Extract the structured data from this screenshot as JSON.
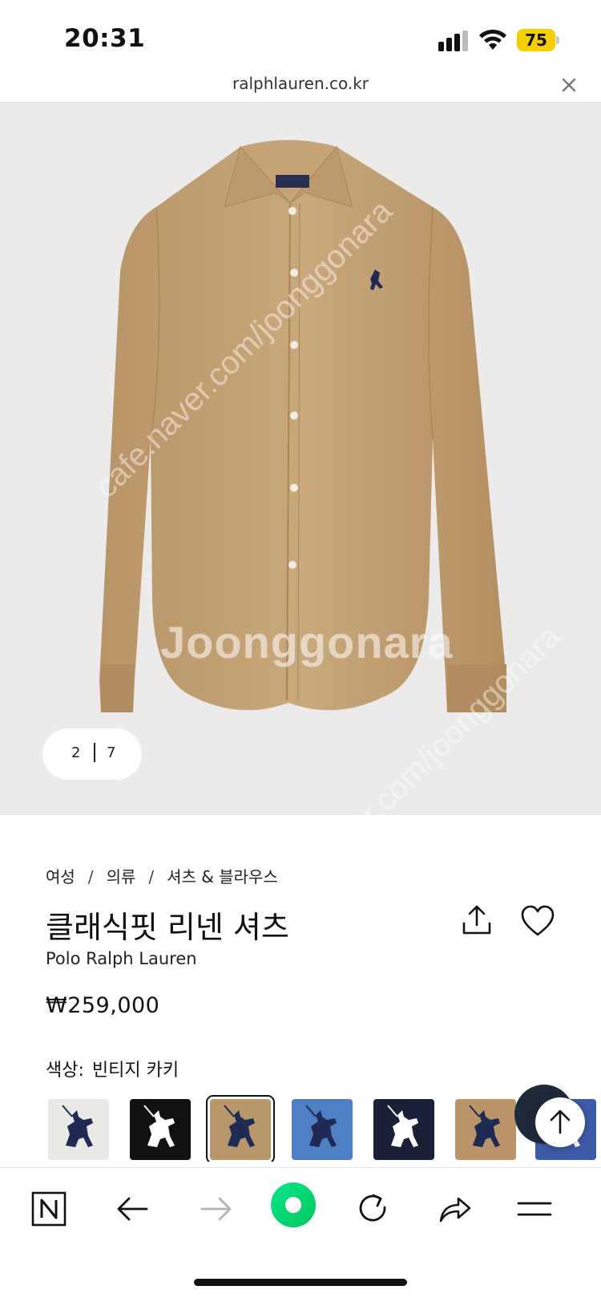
{
  "status_bar": {
    "time": "20:31",
    "battery_level": "75",
    "icons": [
      "signal-icon",
      "wifi-icon",
      "battery-icon"
    ]
  },
  "browser": {
    "url": "ralphlauren.co.kr",
    "close_icon": "close-icon"
  },
  "gallery": {
    "current_page": "2",
    "total_pages": "7",
    "watermark_main": "Joonggonara",
    "watermark_diagonal": "cafe.naver.com/joonggonara"
  },
  "product": {
    "breadcrumb": [
      "여성",
      "의류",
      "셔츠 & 블라우스"
    ],
    "breadcrumb_separator": "/",
    "title": "클래식핏 리넨 셔츠",
    "brand": "Polo Ralph Lauren",
    "price": "₩259,000",
    "color_label": "색상:",
    "color_value": "빈티지 카키",
    "actions": [
      "share-icon",
      "heart-icon"
    ]
  },
  "swatches": [
    {
      "name": "white",
      "bg": "#e9e9e6",
      "logo": "#1f2a55",
      "selected": false
    },
    {
      "name": "black",
      "bg": "#111111",
      "logo": "#ffffff",
      "selected": false
    },
    {
      "name": "vintage-khaki",
      "bg": "#b8976d",
      "logo": "#1f2a55",
      "selected": true
    },
    {
      "name": "blue",
      "bg": "#4f7fc4",
      "logo": "#1f2a55",
      "selected": false
    },
    {
      "name": "navy",
      "bg": "#18203a",
      "logo": "#ffffff",
      "selected": false
    },
    {
      "name": "tan",
      "bg": "#b89468",
      "logo": "#1f2a55",
      "selected": false
    },
    {
      "name": "royal-blue",
      "bg": "#3c5aa5",
      "logo": "#ffffff",
      "selected": false
    }
  ],
  "toolbar": {
    "items": [
      "naver-n-icon",
      "back-arrow-icon",
      "forward-arrow-icon",
      "green-circle-icon",
      "refresh-icon",
      "share-arrow-icon",
      "menu-icon"
    ]
  },
  "colors": {
    "hero_bg": "#ecebea",
    "shirt": "#c4a57a",
    "battery": "#f5cf00",
    "green_button": "#10d96f"
  }
}
